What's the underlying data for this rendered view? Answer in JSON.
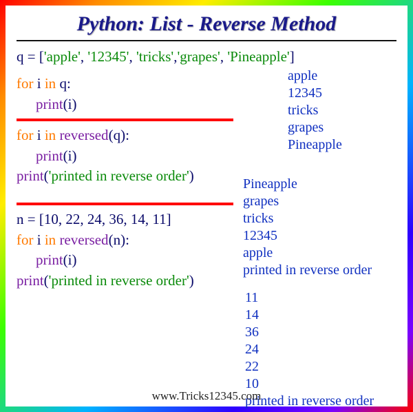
{
  "title": "Python: List - Reverse Method",
  "code1": {
    "assign_var": "q",
    "assign_eq": " = [",
    "s1": "'apple'",
    "s2": "'12345'",
    "s3": "'tricks'",
    "s4": "'grapes'",
    "s5": "'Pineapple'",
    "close": "]",
    "for_kw": "for ",
    "i_kw": "i ",
    "in_kw": "in  ",
    "q_var": "q",
    "colon": ":",
    "print_kw": "print",
    "open_p": "(",
    "i_arg": "i",
    "close_p": ")"
  },
  "output1": [
    "apple",
    "12345",
    "tricks",
    "grapes",
    "Pineapple"
  ],
  "code2": {
    "for_kw": "for ",
    "i_kw": "i ",
    "in_kw": "in  ",
    "rev_kw": "reversed",
    "open_p": "(",
    "q_var": "q",
    "close_p": ")",
    "colon": ":",
    "print_kw": "print",
    "i_arg": "i",
    "msg": "'printed in reverse order'"
  },
  "output2": [
    "Pineapple",
    "grapes",
    "tricks",
    "12345",
    "apple",
    "printed in reverse order"
  ],
  "code3": {
    "assign_var": "n",
    "assign_eq": " = [",
    "nums": "10, 22, 24, 36, 14, 11",
    "close": "]",
    "for_kw": "for ",
    "i_kw": "i ",
    "in_kw": "in  ",
    "rev_kw": "reversed",
    "open_p": "(",
    "n_var": "n",
    "close_p": ")",
    "colon": ":",
    "print_kw": "print",
    "i_arg": "i",
    "msg": "'printed in reverse order'"
  },
  "output3": [
    "11",
    "14",
    "36",
    "24",
    "22",
    "10",
    "printed in reverse order"
  ],
  "footer": "www.Tricks12345.com"
}
